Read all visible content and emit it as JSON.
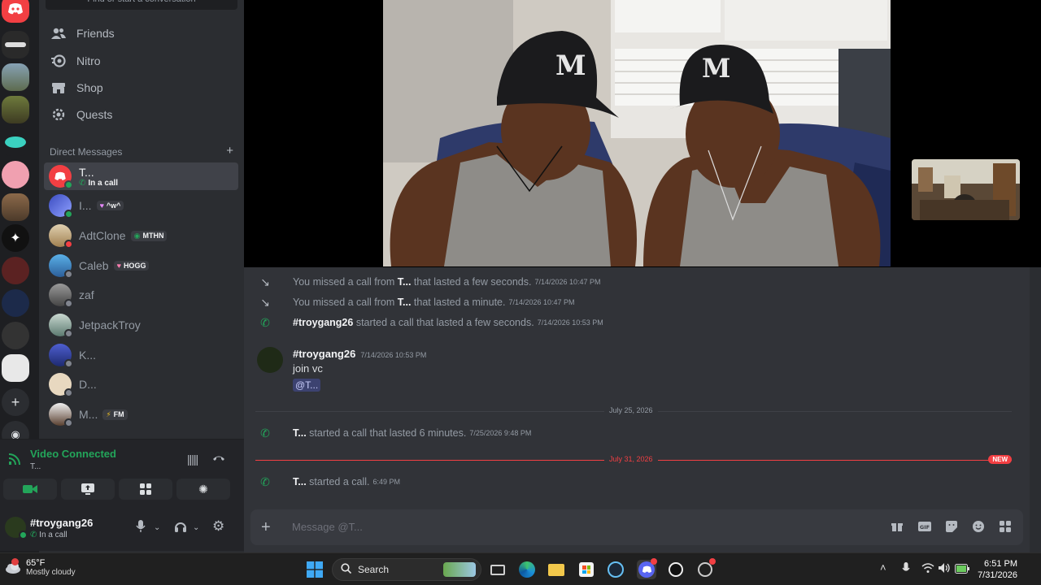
{
  "sidebar": {
    "find_placeholder": "Find or start a conversation",
    "nav": [
      {
        "label": "Friends",
        "icon": "friends-icon"
      },
      {
        "label": "Nitro",
        "icon": "nitro-icon"
      },
      {
        "label": "Shop",
        "icon": "shop-icon"
      },
      {
        "label": "Quests",
        "icon": "quests-icon"
      }
    ],
    "dm_header": "Direct Messages",
    "dms": [
      {
        "name": "T...",
        "sub": "In a call",
        "status": "#23a55a"
      },
      {
        "name": "I...",
        "tag": "^w^",
        "status": "#23a55a"
      },
      {
        "name": "AdtClone",
        "tag": "MTHN",
        "status": "#f23f43"
      },
      {
        "name": "Caleb",
        "tag": "HOGG",
        "status": "#80848e"
      },
      {
        "name": "zaf",
        "status": "#80848e"
      },
      {
        "name": "JetpackTroy",
        "status": "#80848e"
      },
      {
        "name": "K...",
        "status": "#80848e"
      },
      {
        "name": "D...",
        "status": "#80848e"
      },
      {
        "name": "M...",
        "tag": "FM",
        "status": "#80848e"
      }
    ]
  },
  "voice": {
    "title": "Video Connected",
    "channel": "T..."
  },
  "user": {
    "name": "#troygang26",
    "status": "In a call"
  },
  "chat": {
    "lines": [
      {
        "pre": "You missed a call from ",
        "who": "T...",
        "post": " that lasted a few seconds.",
        "time": "7/14/2026 10:47 PM",
        "kind": "missed"
      },
      {
        "pre": "You missed a call from ",
        "who": "T...",
        "post": " that lasted a minute.",
        "time": "7/14/2026 10:47 PM",
        "kind": "missed"
      },
      {
        "pre": "",
        "who": "#troygang26",
        "post": " started a call that lasted a few seconds.",
        "time": "7/14/2026 10:53 PM",
        "kind": "call"
      }
    ],
    "message": {
      "author": "#troygang26",
      "time": "7/14/2026 10:53 PM",
      "text": "join vc",
      "mention": "@T..."
    },
    "divider1": "July 25, 2026",
    "line4": {
      "who": "T...",
      "post": " started a call that lasted 6 minutes.",
      "time": "7/25/2026 9:48 PM"
    },
    "divider2": "July 31, 2026",
    "new_label": "NEW",
    "line5": {
      "who": "T...",
      "post": " started a call.",
      "time": "6:49 PM"
    },
    "placeholder": "Message @T..."
  },
  "taskbar": {
    "temp": "65°F",
    "weather": "Mostly cloudy",
    "search_label": "Search",
    "time": "6:51 PM",
    "date": "7/31/2026"
  },
  "colors": {
    "green": "#23a55a",
    "red": "#f23f43",
    "blurple": "#5865f2"
  }
}
